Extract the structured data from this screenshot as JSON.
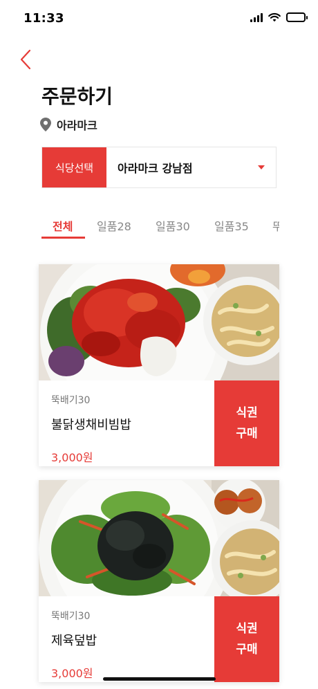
{
  "status_bar": {
    "time": "11:33",
    "icons": [
      "signal-icon",
      "wifi-icon",
      "battery-icon"
    ]
  },
  "header": {
    "back_icon": "chevron-left-icon",
    "title": "주문하기",
    "location_icon": "location-pin-icon",
    "location": "아라마크"
  },
  "restaurant_select": {
    "label": "식당선택",
    "value": "아라마크 강남점",
    "arrow_icon": "caret-down-icon"
  },
  "tabs": [
    {
      "label": "전체",
      "active": true
    },
    {
      "label": "일품28",
      "active": false
    },
    {
      "label": "일품30",
      "active": false
    },
    {
      "label": "일품35",
      "active": false
    },
    {
      "label": "뚜",
      "active": false
    }
  ],
  "menu_items": [
    {
      "category": "뚝배기30",
      "name": "불닭생채비빔밥",
      "price": "3,000원",
      "buy_line1": "식권",
      "buy_line2": "구매"
    },
    {
      "category": "뚝배기30",
      "name": "제육덮밥",
      "price": "3,000원",
      "buy_line1": "식권",
      "buy_line2": "구매"
    }
  ],
  "colors": {
    "accent": "#e63b37",
    "text_primary": "#111111",
    "text_secondary": "#888888"
  }
}
